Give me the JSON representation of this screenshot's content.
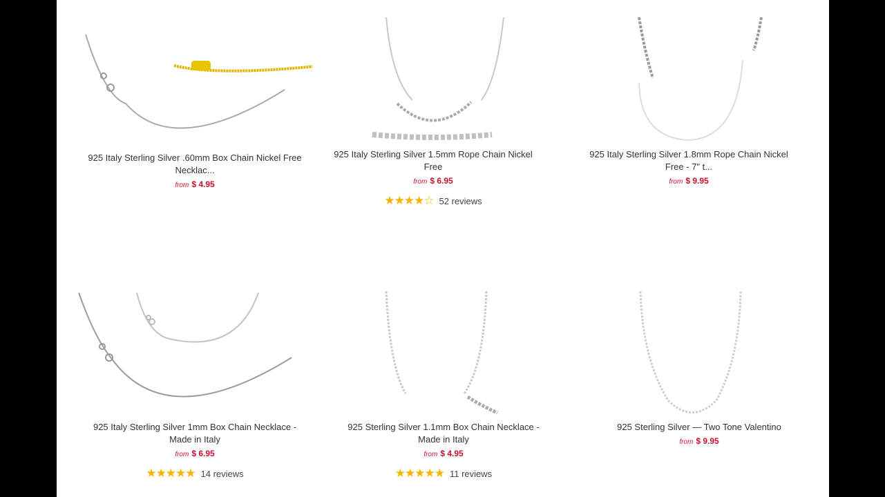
{
  "products": [
    {
      "title": "925 Italy Sterling Silver .60mm Box Chain Nickel Free Necklac...",
      "from": "from",
      "price": "$ 4.95",
      "stars": "",
      "reviews": ""
    },
    {
      "title": "925 Italy Sterling Silver 1.5mm Rope Chain Nickel Free",
      "from": "from",
      "price": "$ 6.95",
      "stars": "★★★★☆",
      "reviews": "52 reviews",
      "rating": 4.5
    },
    {
      "title": "925 Italy Sterling Silver 1.8mm Rope Chain Nickel Free - 7\" t...",
      "from": "from",
      "price": "$ 9.95",
      "stars": "",
      "reviews": ""
    },
    {
      "title": "925 Italy Sterling Silver 1mm Box Chain Necklace - Made in Italy",
      "from": "from",
      "price": "$ 6.95",
      "stars": "★★★★★",
      "reviews": "14 reviews",
      "rating": 5
    },
    {
      "title": "925 Sterling Silver 1.1mm Box Chain Necklace - Made in Italy",
      "from": "from",
      "price": "$ 4.95",
      "stars": "★★★★★",
      "reviews": "11 reviews",
      "rating": 5
    },
    {
      "title": "925 Sterling Silver — Two Tone Valentino",
      "from": "from",
      "price": "$ 9.95",
      "stars": "",
      "reviews": ""
    }
  ],
  "colors": {
    "price": "#c8102e",
    "star": "#f4b400",
    "chain": "#b8b8b8",
    "gold": "#e0b400"
  }
}
